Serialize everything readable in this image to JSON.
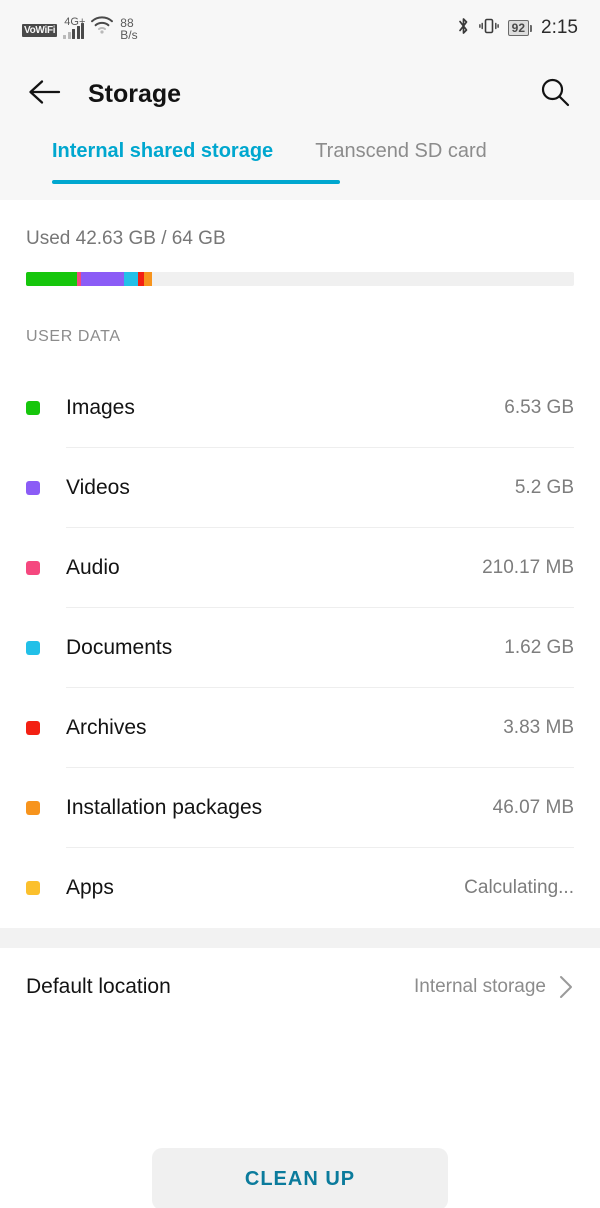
{
  "statusbar": {
    "vowifi_badge": "VoWiFi",
    "network_type": "4G+",
    "data_rate_value": "88",
    "data_rate_unit": "B/s",
    "battery_percent": "92",
    "time": "2:15",
    "icons": [
      "wifi-icon",
      "bluetooth-icon",
      "vibrate-icon",
      "battery-icon"
    ]
  },
  "appbar": {
    "back_icon": "back-arrow-icon",
    "title": "Storage",
    "search_icon": "search-icon"
  },
  "tabs": [
    {
      "label": "Internal shared storage",
      "active": true
    },
    {
      "label": "Transcend SD card",
      "active": false
    }
  ],
  "summary": {
    "used_text": "Used 42.63 GB / 64 GB",
    "used_gb": 42.63,
    "total_gb": 64
  },
  "section": {
    "user_data_header": "USER DATA"
  },
  "storage_items": [
    {
      "label": "Images",
      "value": "6.53 GB",
      "color": "#16c60c"
    },
    {
      "label": "Videos",
      "value": "5.2 GB",
      "color": "#8b5cf6"
    },
    {
      "label": "Audio",
      "value": "210.17 MB",
      "color": "#f5487f"
    },
    {
      "label": "Documents",
      "value": "1.62 GB",
      "color": "#22c0e8"
    },
    {
      "label": "Archives",
      "value": "3.83 MB",
      "color": "#f32013"
    },
    {
      "label": "Installation packages",
      "value": "46.07 MB",
      "color": "#f7941d"
    },
    {
      "label": "Apps",
      "value": "Calculating...",
      "color": "#fbc02d"
    }
  ],
  "usage_bar": [
    {
      "name": "Images",
      "color": "#16c60c",
      "width_pct": 9.3
    },
    {
      "name": "Audio",
      "color": "#f5487f",
      "width_pct": 0.8
    },
    {
      "name": "Videos",
      "color": "#8b5cf6",
      "width_pct": 7.7
    },
    {
      "name": "Documents",
      "color": "#22c0e8",
      "width_pct": 2.7
    },
    {
      "name": "Archives",
      "color": "#f32013",
      "width_pct": 1.0
    },
    {
      "name": "Installation packages",
      "color": "#f7941d",
      "width_pct": 1.5
    }
  ],
  "default_location": {
    "label": "Default location",
    "value": "Internal storage",
    "chevron_icon": "chevron-right-icon"
  },
  "cleanup": {
    "label": "CLEAN UP"
  },
  "colors": {
    "accent": "#00a7cf",
    "cleanup_text": "#0b7b9c",
    "header_bg": "#f7f7f7",
    "track": "#f0f0f0"
  }
}
